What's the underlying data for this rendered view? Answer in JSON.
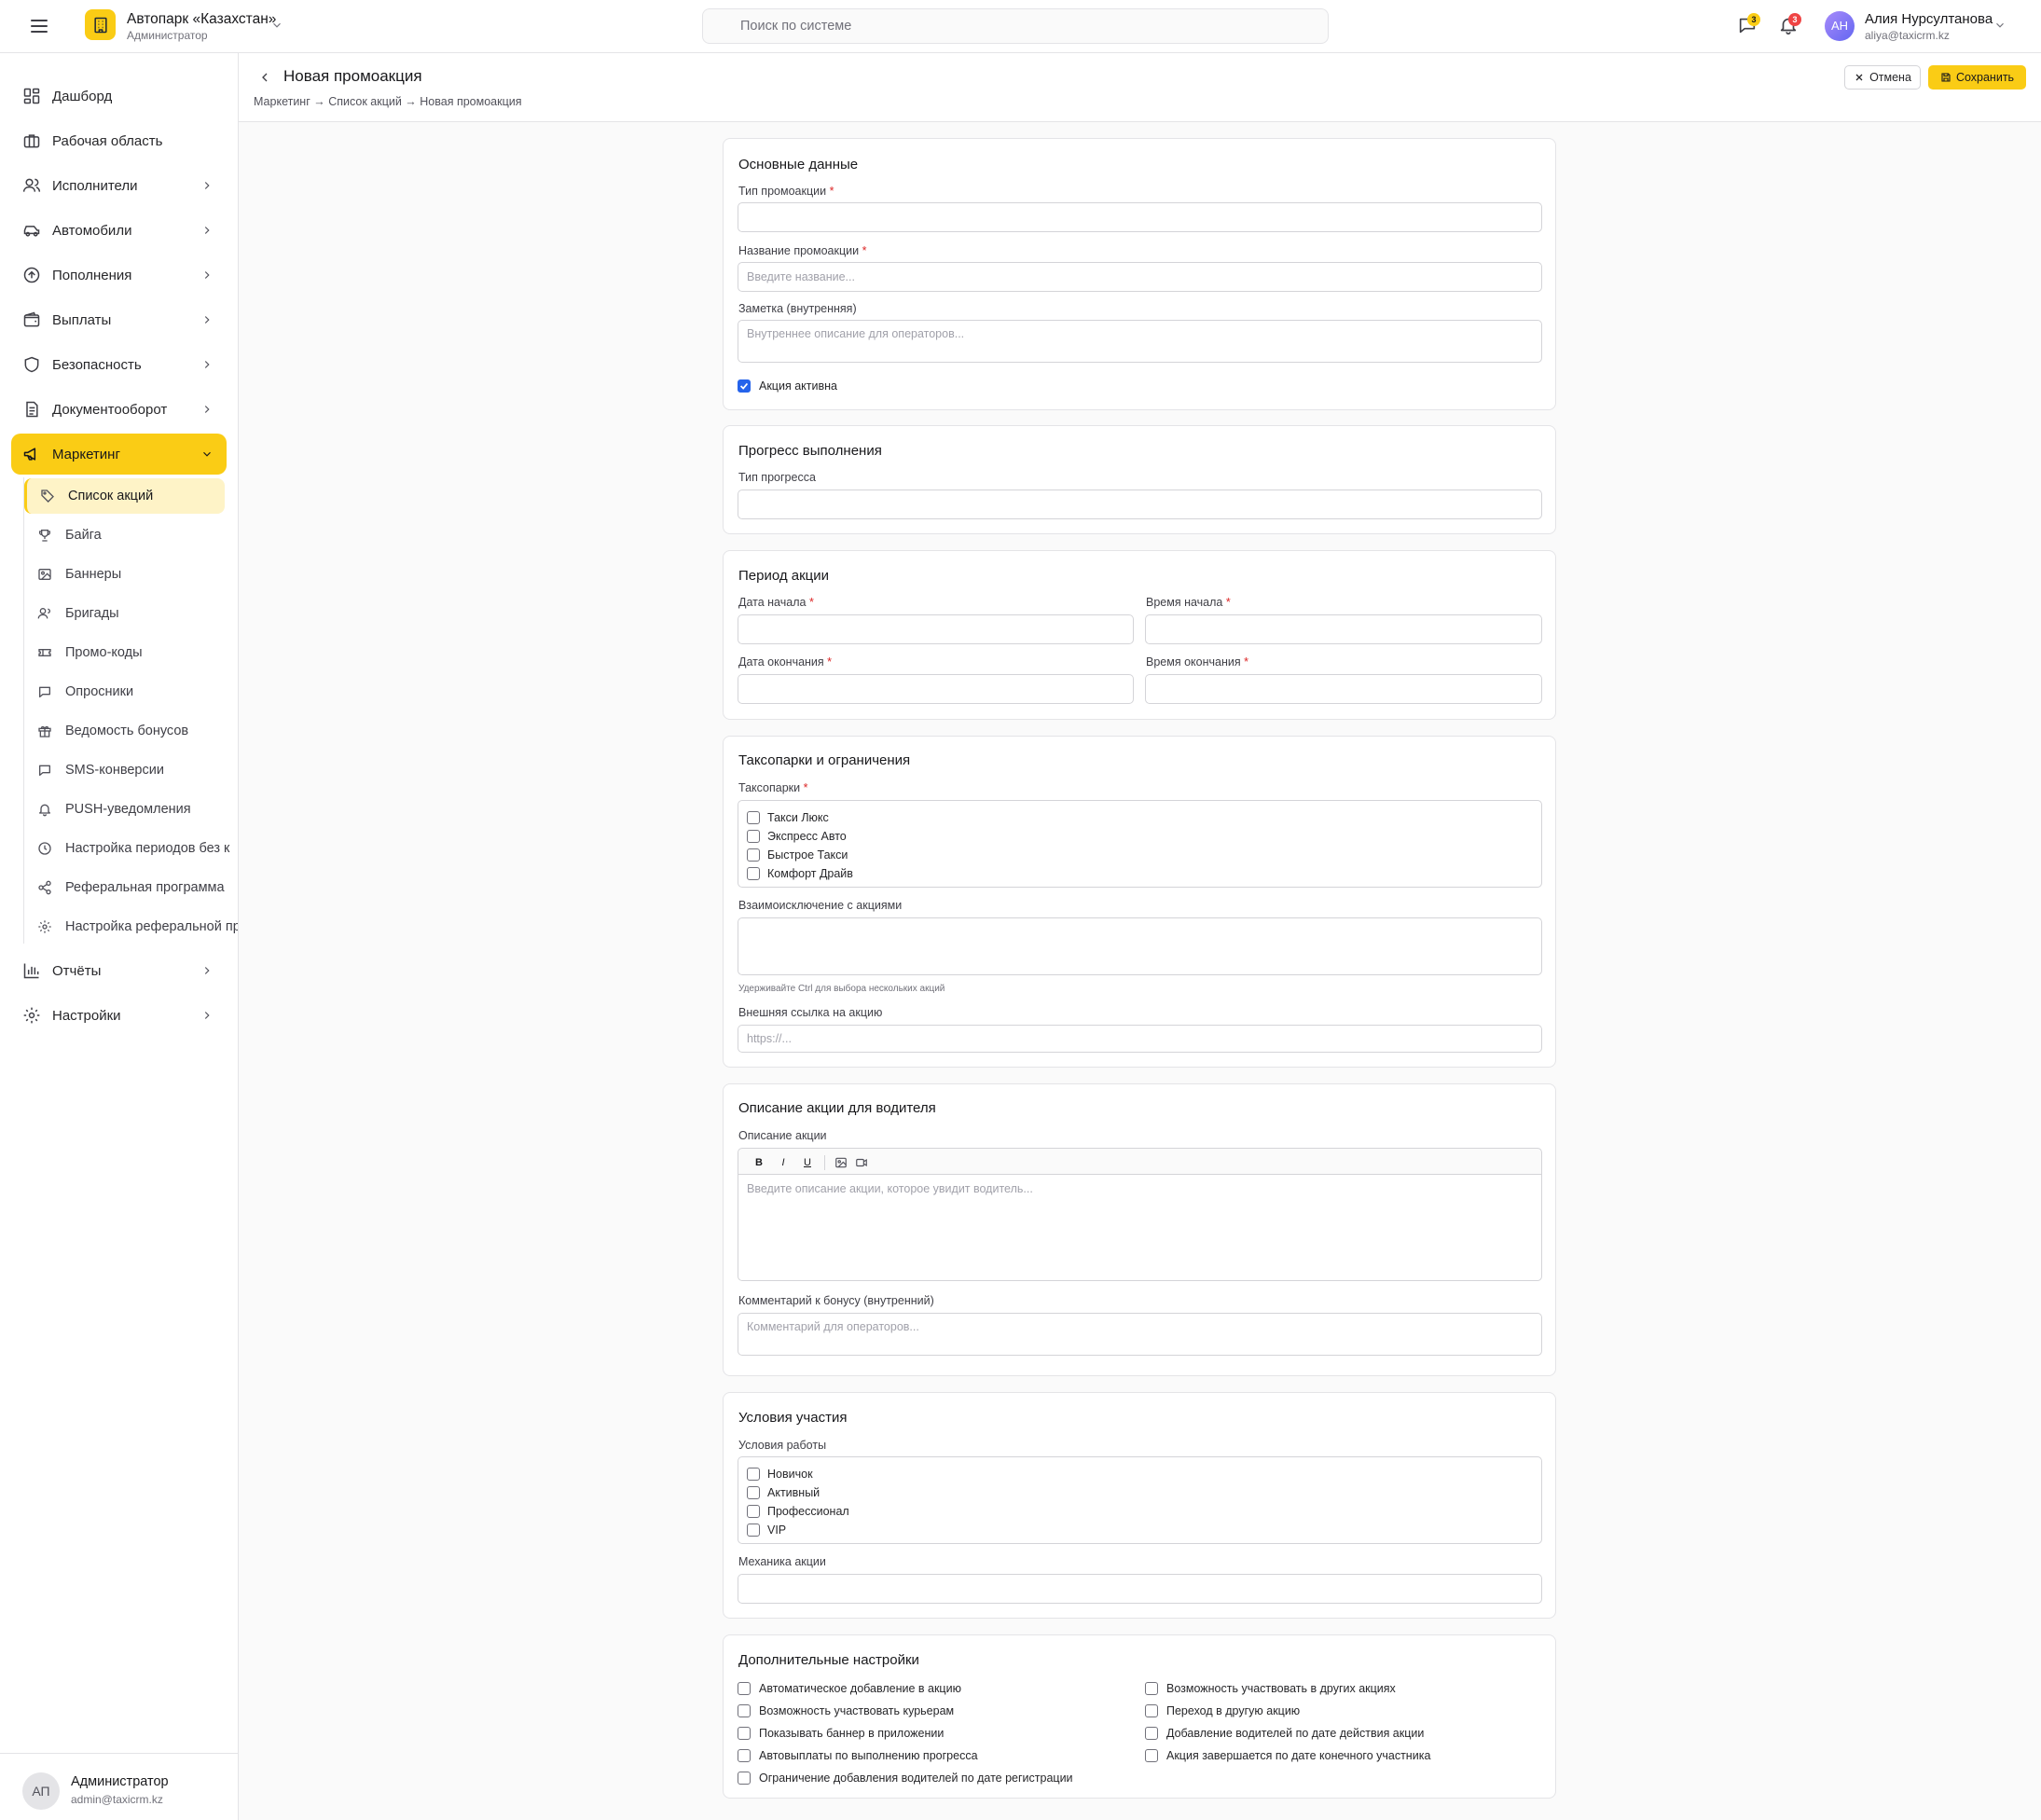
{
  "topbar": {
    "org_name": "Автопарк «Казахстан»",
    "org_role": "Администратор",
    "search_placeholder": "Поиск по системе",
    "messages_count": "3",
    "notifications_count": "3",
    "user_initials": "АН",
    "user_name": "Алия Нурсултанова",
    "user_email": "aliya@taxicrm.kz"
  },
  "sidebar": {
    "items": [
      {
        "label": "Дашборд",
        "icon": "dashboard-icon"
      },
      {
        "label": "Рабочая область",
        "icon": "briefcase-icon"
      },
      {
        "label": "Исполнители",
        "icon": "users-icon"
      },
      {
        "label": "Автомобили",
        "icon": "car-icon"
      },
      {
        "label": "Пополнения",
        "icon": "arrow-up-circle-icon"
      },
      {
        "label": "Выплаты",
        "icon": "wallet-icon"
      },
      {
        "label": "Безопасность",
        "icon": "shield-icon"
      },
      {
        "label": "Документооборот",
        "icon": "document-icon"
      },
      {
        "label": "Маркетинг",
        "icon": "megaphone-icon"
      }
    ],
    "marketing_sub": [
      {
        "label": "Список акций",
        "icon": "tag-icon"
      },
      {
        "label": "Байга",
        "icon": "trophy-icon"
      },
      {
        "label": "Баннеры",
        "icon": "image-icon"
      },
      {
        "label": "Бригады",
        "icon": "team-icon"
      },
      {
        "label": "Промо-коды",
        "icon": "ticket-icon"
      },
      {
        "label": "Опросники",
        "icon": "chat-icon"
      },
      {
        "label": "Ведомость бонусов",
        "icon": "gift-icon"
      },
      {
        "label": "SMS-конверсии",
        "icon": "message-icon"
      },
      {
        "label": "PUSH-уведомления",
        "icon": "bell-icon"
      },
      {
        "label": "Настройка периодов без к",
        "icon": "clock-icon"
      },
      {
        "label": "Реферальная программа",
        "icon": "share-icon"
      },
      {
        "label": "Настройка реферальной пр",
        "icon": "gear-icon"
      }
    ],
    "bottom_items": [
      {
        "label": "Отчёты",
        "icon": "bar-chart-icon"
      },
      {
        "label": "Настройки",
        "icon": "gear-icon"
      }
    ],
    "account_initials": "АП",
    "account_name": "Администратор",
    "account_email": "admin@taxicrm.kz"
  },
  "header": {
    "title": "Новая промоакция",
    "breadcrumb": "Маркетинг → Список акций → Новая промоакция",
    "cancel_label": "Отмена",
    "save_label": "Сохранить"
  },
  "form": {
    "basic": {
      "title": "Основные данные",
      "type_label": "Тип промоакции",
      "name_label": "Название промоакции",
      "name_placeholder": "Введите название...",
      "note_label": "Заметка (внутренняя)",
      "note_placeholder": "Внутреннее описание для операторов...",
      "active_label": "Акция активна",
      "active_checked": true
    },
    "progress": {
      "title": "Прогресс выполнения",
      "type_label": "Тип прогресса"
    },
    "period": {
      "title": "Период акции",
      "start_date_label": "Дата начала",
      "start_time_label": "Время начала",
      "end_date_label": "Дата окончания",
      "end_time_label": "Время окончания"
    },
    "parks": {
      "title": "Таксопарки и ограничения",
      "parks_label": "Таксопарки",
      "parks_options": [
        "Такси Люкс",
        "Экспресс Авто",
        "Быстрое Такси",
        "Комфорт Драйв"
      ],
      "exclusion_label": "Взаимоисключение с акциями",
      "exclusion_hint": "Удерживайте Ctrl для выбора нескольких акций",
      "link_label": "Внешняя ссылка на акцию",
      "link_placeholder": "https://..."
    },
    "description": {
      "title": "Описание акции для водителя",
      "desc_label": "Описание акции",
      "desc_placeholder": "Введите описание акции, которое увидит водитель...",
      "toolbar_bold": "B",
      "toolbar_italic": "I",
      "toolbar_underline": "U",
      "comment_label": "Комментарий к бонусу (внутренний)",
      "comment_placeholder": "Комментарий для операторов..."
    },
    "conditions": {
      "title": "Условия участия",
      "work_label": "Условия работы",
      "work_options": [
        "Новичок",
        "Активный",
        "Профессионал",
        "VIP"
      ],
      "mechanics_label": "Механика акции"
    },
    "extra": {
      "title": "Дополнительные настройки",
      "left": [
        "Автоматическое добавление в акцию",
        "Возможность участвовать курьерам",
        "Показывать баннер в приложении",
        "Автовыплаты по выполнению прогресса",
        "Ограничение добавления водителей по дате регистрации"
      ],
      "right": [
        "Возможность участвовать в других акциях",
        "Переход в другую акцию",
        "Добавление водителей по дате действия акции",
        "Акция завершается по дате конечного участника"
      ]
    }
  },
  "colors": {
    "accent": "#facc15",
    "active_sub_bg": "#fef3c7",
    "checkbox": "#2563eb",
    "required": "#dc2626"
  }
}
